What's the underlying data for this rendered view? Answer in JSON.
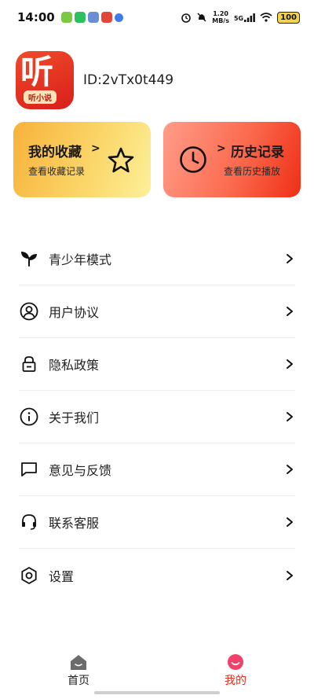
{
  "status_bar": {
    "time": "14:00",
    "net_speed_value": "1.20",
    "net_speed_unit": "MB/s",
    "network_type": "5G",
    "battery": "100"
  },
  "profile": {
    "avatar_text": "听",
    "avatar_ribbon": "听小说",
    "user_id": "ID:2vTx0t449"
  },
  "cards": {
    "favorites": {
      "title": "我的收藏",
      "subtitle": "查看收藏记录",
      "icon": "star-icon"
    },
    "history": {
      "title": "历史记录",
      "subtitle": "查看历史播放",
      "icon": "clock-icon"
    }
  },
  "menu": [
    {
      "label": "青少年模式",
      "icon": "sprout-icon"
    },
    {
      "label": "用户协议",
      "icon": "user-circle-icon"
    },
    {
      "label": "隐私政策",
      "icon": "lock-icon"
    },
    {
      "label": "关于我们",
      "icon": "info-icon"
    },
    {
      "label": "意见与反馈",
      "icon": "chat-bubble-icon"
    },
    {
      "label": "联系客服",
      "icon": "headset-icon"
    },
    {
      "label": "设置",
      "icon": "hexagon-settings-icon"
    }
  ],
  "bottom_nav": {
    "home": "首页",
    "me": "我的",
    "active": "me"
  },
  "colors": {
    "accent": "#e72e1e",
    "fav_card_start": "#f7b23a",
    "fav_card_end": "#fdf09a",
    "hist_card_start": "#ff9d8a",
    "hist_card_end": "#ef2f16"
  }
}
